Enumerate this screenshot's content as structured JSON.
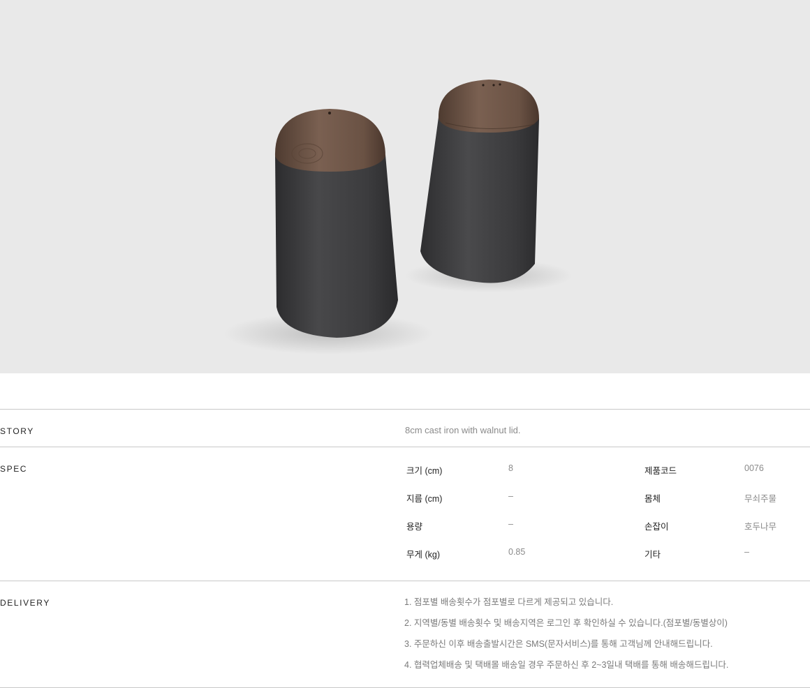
{
  "story": {
    "label": "STORY",
    "text": "8cm cast iron with walnut lid."
  },
  "spec": {
    "label": "SPEC",
    "rows": [
      {
        "k1": "크기 (cm)",
        "v1": "8",
        "k2": "제품코드",
        "v2": "0076"
      },
      {
        "k1": "지름 (cm)",
        "v1": "–",
        "k2": "몸체",
        "v2": "무쇠주물"
      },
      {
        "k1": "용량",
        "v1": "–",
        "k2": "손잡이",
        "v2": "호두나무"
      },
      {
        "k1": "무게 (kg)",
        "v1": "0.85",
        "k2": "기타",
        "v2": "–"
      }
    ]
  },
  "delivery": {
    "label": "DELIVERY",
    "items": [
      "1. 점포별 배송횟수가 점포별로 다르게 제공되고 있습니다.",
      "2. 지역별/동별 배송횟수 및 배송지역은 로그인 후 확인하실 수 있습니다.(점포별/동별상이)",
      "3. 주문하신 이후 배송출발시간은 SMS(문자서비스)를 통해 고객님께 안내해드립니다.",
      "4. 협력업체배송 및 택배몰 배송일 경우 주문하신 후 2~3일내 택배를 통해 배송해드립니다."
    ]
  },
  "colors": {
    "hero_bg": "#e9e9e9",
    "iron": "#3a3a3c",
    "walnut": "#6b5344",
    "rule": "#c8c8c8"
  }
}
